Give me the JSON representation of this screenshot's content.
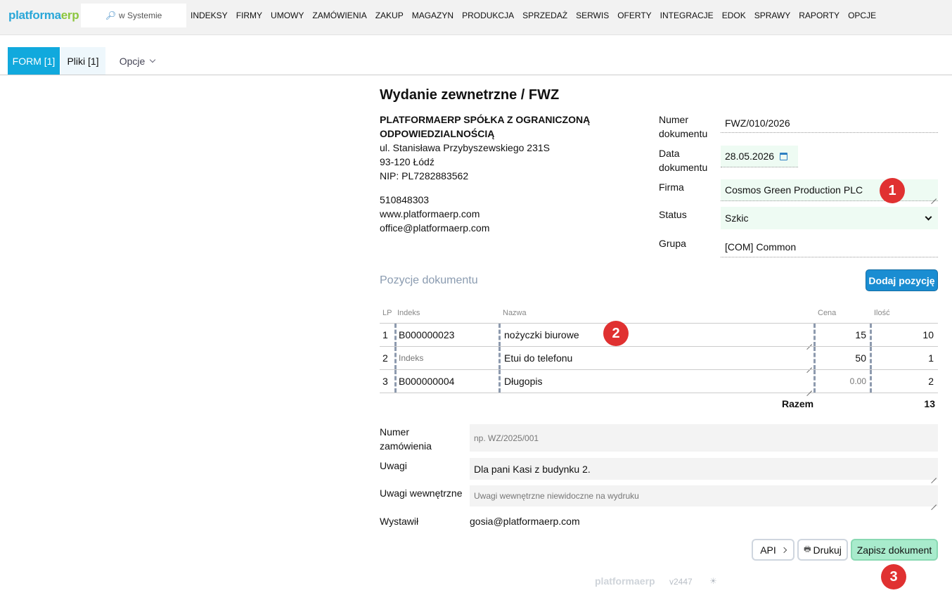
{
  "app": {
    "logo_a": "platforma",
    "logo_b": "erp"
  },
  "search": {
    "label": "w Systemie",
    "icon": "magnifier-icon"
  },
  "nav": [
    "INDEKSY",
    "FIRMY",
    "UMOWY",
    "ZAMÓWIENIA",
    "ZAKUP",
    "MAGAZYN",
    "PRODUKCJA",
    "SPRZEDAŻ",
    "SERWIS",
    "OFERTY",
    "INTEGRACJE",
    "EDOK",
    "SPRAWY",
    "RAPORTY",
    "OPCJE"
  ],
  "tabs": {
    "form": "FORM [1]",
    "pliki": "Pliki [1]",
    "opcje": "Opcje"
  },
  "doc": {
    "title": "Wydanie zewnetrzne / FWZ",
    "company_name_1": "PLATFORMAERP SPÓŁKA Z OGRANICZONĄ",
    "company_name_2": "ODPOWIEDZIALNOŚCIĄ",
    "street": "ul. Stanisława Przybyszewskiego 231S",
    "city": "93-120 Łódź",
    "nip": "NIP: PL7282883562",
    "phone": "510848303",
    "www": "www.platformaerp.com",
    "email": "office@platformaerp.com"
  },
  "fields": {
    "numer_label_1": "Numer",
    "numer_label_2": "dokumentu",
    "numer_value": "FWZ/010/2026",
    "data_label_1": "Data",
    "data_label_2": "dokumentu",
    "data_value": "28.05.2026",
    "firma_label": "Firma",
    "firma_value": "Cosmos Green Production PLC",
    "status_label": "Status",
    "status_value": "Szkic",
    "grupa_label": "Grupa",
    "grupa_value": "[COM] Common"
  },
  "positions": {
    "title": "Pozycje dokumentu",
    "add_button": "Dodaj pozycję",
    "headers": {
      "lp": "LP",
      "indeks": "Indeks",
      "nazwa": "Nazwa",
      "cena": "Cena",
      "ilosc": "Ilość"
    },
    "rows": [
      {
        "lp": "1",
        "indeks": "B000000023",
        "indeks_placeholder": "",
        "nazwa": "nożyczki biurowe",
        "cena": "15",
        "cena_placeholder": "",
        "ilosc": "10"
      },
      {
        "lp": "2",
        "indeks": "",
        "indeks_placeholder": "Indeks",
        "nazwa": "Etui do telefonu",
        "cena": "50",
        "cena_placeholder": "",
        "ilosc": "1"
      },
      {
        "lp": "3",
        "indeks": "B000000004",
        "indeks_placeholder": "",
        "nazwa": "Długopis",
        "cena": "",
        "cena_placeholder": "0.00",
        "ilosc": "2"
      }
    ],
    "razem_label": "Razem",
    "razem_value": "13"
  },
  "extra": {
    "zam_label_1": "Numer",
    "zam_label_2": "zamówienia",
    "zam_placeholder": "np. WZ/2025/001",
    "uwagi_label": "Uwagi",
    "uwagi_value": "Dla pani Kasi z budynku 2.",
    "uwagi_wew_label": "Uwagi wewnętrzne",
    "uwagi_wew_placeholder": "Uwagi wewnętrzne niewidoczne na wydruku",
    "wystawil_label": "Wystawił",
    "wystawil_value": "gosia@platformaerp.com"
  },
  "actions": {
    "api": "API",
    "drukuj": "Drukuj",
    "zapisz": "Zapisz dokument"
  },
  "badges": [
    "1",
    "2",
    "3"
  ],
  "footer": {
    "logo_a": "platforma",
    "logo_b": "erp",
    "version": "v2447"
  },
  "colors": {
    "accent": "#11a9dd",
    "primary_button": "#1a8dd2",
    "save_button": "#a8ebcc",
    "badge": "#e03131",
    "field_green": "#eefbf3"
  }
}
